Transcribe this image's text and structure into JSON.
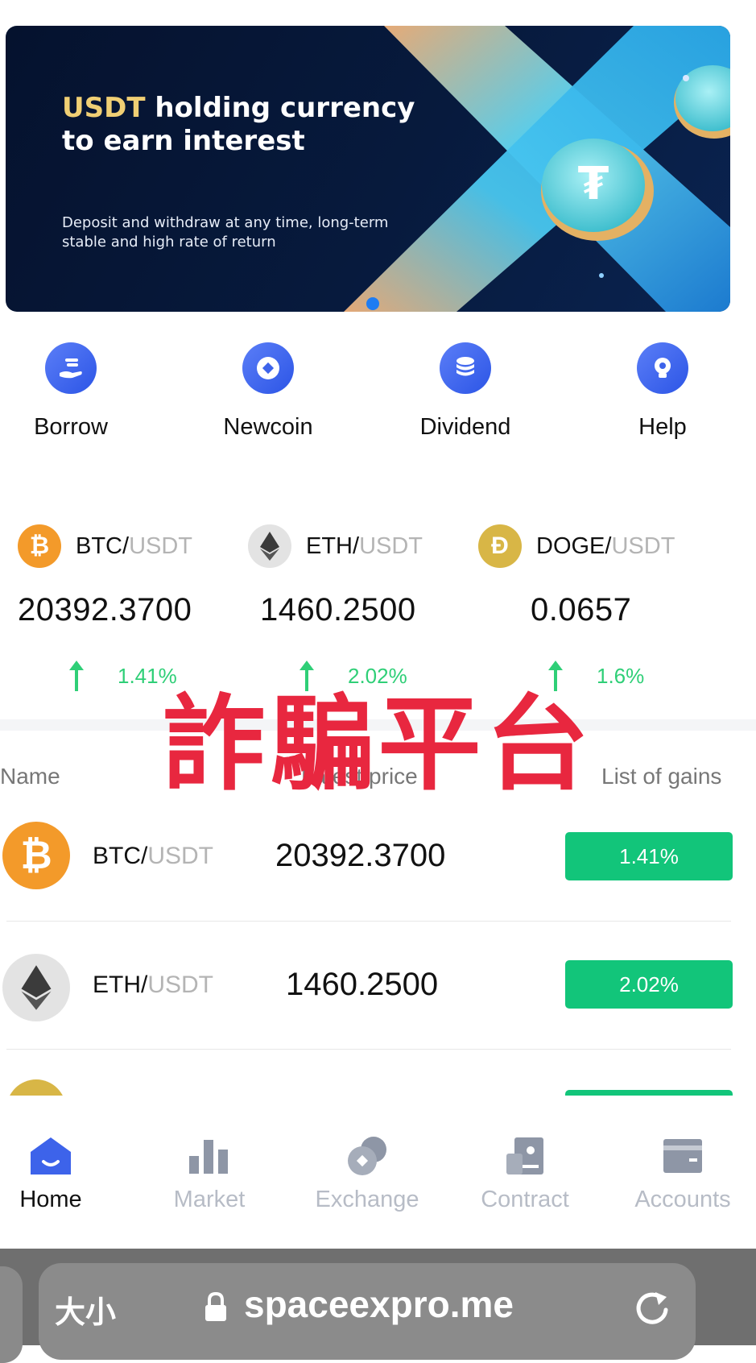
{
  "banner": {
    "title_highlight": "USDT",
    "title_rest": " holding currency",
    "title_line2": "to earn interest",
    "subtitle": "Deposit and withdraw at any time, long-term stable and high rate of return"
  },
  "quick_actions": [
    {
      "label": "Borrow",
      "icon": "hand-coin-icon"
    },
    {
      "label": "Newcoin",
      "icon": "newcoin-icon"
    },
    {
      "label": "Dividend",
      "icon": "coin-stack-icon"
    },
    {
      "label": "Help",
      "icon": "lightbulb-icon"
    }
  ],
  "tickers": [
    {
      "base": "BTC/",
      "quote": "USDT",
      "price": "20392.3700",
      "change": "1.41%"
    },
    {
      "base": "ETH/",
      "quote": "USDT",
      "price": "1460.2500",
      "change": "2.02%"
    },
    {
      "base": "DOGE/",
      "quote": "USDT",
      "price": "0.0657",
      "change": "1.6%"
    }
  ],
  "watermark": "詐騙平台",
  "list": {
    "headers": {
      "name": "Name",
      "price": "Latest price",
      "gains": "List of gains"
    },
    "rows": [
      {
        "base": "BTC/",
        "quote": "USDT",
        "price": "20392.3700",
        "gain": "1.41%"
      },
      {
        "base": "ETH/",
        "quote": "USDT",
        "price": "1460.2500",
        "gain": "2.02%"
      }
    ]
  },
  "nav": [
    {
      "label": "Home",
      "active": true
    },
    {
      "label": "Market"
    },
    {
      "label": "Exchange"
    },
    {
      "label": "Contract"
    },
    {
      "label": "Accounts"
    }
  ],
  "colors": {
    "accent": "#3d63ea",
    "gain_green": "#12c57a",
    "up_arrow": "#2fcf77",
    "watermark_red": "#e8273f",
    "banner_bg": "#071a3d",
    "highlight_gold": "#f0cf74"
  },
  "browser": {
    "text_size_label": "大小",
    "url": "spaceexpro.me"
  }
}
